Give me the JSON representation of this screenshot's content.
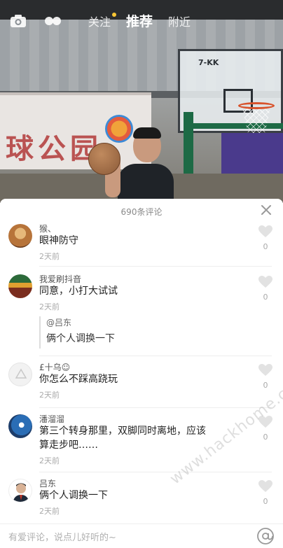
{
  "topbar": {
    "tabs": [
      {
        "label": "关注"
      },
      {
        "label": "推荐"
      },
      {
        "label": "附近"
      }
    ]
  },
  "comments_sheet": {
    "count_label": "690条评论",
    "comments": [
      {
        "name": "猴、",
        "text": "眼神防守",
        "time": "2天前",
        "likes": "0"
      },
      {
        "name": "我爱刷抖音",
        "text": "同意，小打大试试",
        "time": "2天前",
        "likes": "0",
        "quote": {
          "name": "@吕东",
          "text": "俩个人调换一下"
        }
      },
      {
        "name": "£十乌☺",
        "text": "你怎么不踩高跷玩",
        "time": "2天前",
        "likes": "0"
      },
      {
        "name": "潘溜溜",
        "text": "第三个转身那里，双脚同时离地，应该算走步吧……",
        "time": "2天前",
        "likes": "0"
      },
      {
        "name": "吕东",
        "text": "俩个人调换一下",
        "time": "2天前",
        "likes": "0"
      }
    ]
  },
  "input": {
    "placeholder": "有爱评论，说点儿好听的~"
  },
  "watermark": "www.hackhome.com",
  "colors": {
    "accent_follow_dot": "#f7c534",
    "rim": "#d8532c"
  }
}
